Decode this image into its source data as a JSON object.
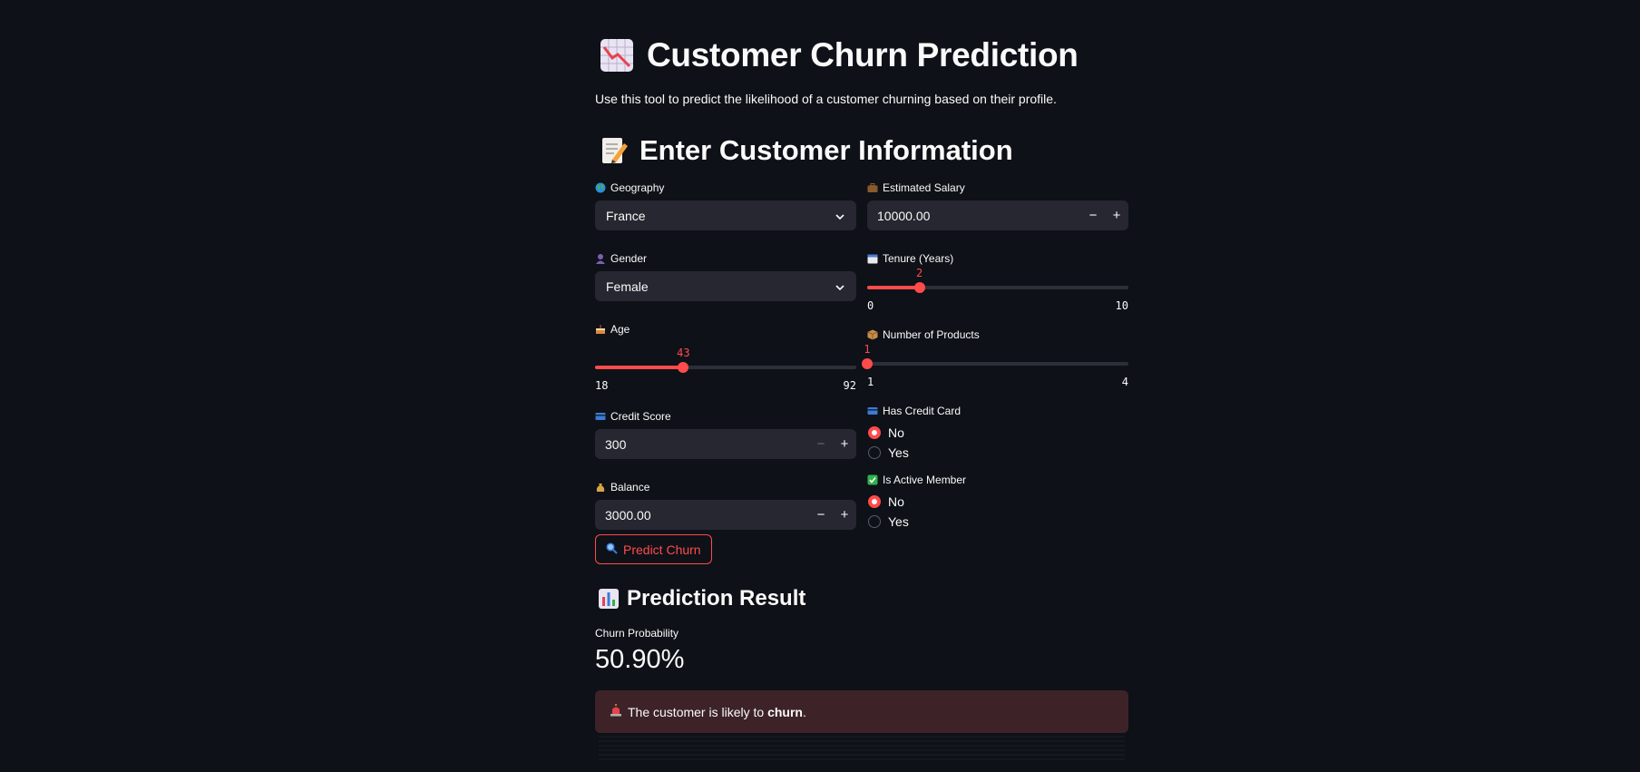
{
  "title": "Customer Churn Prediction",
  "subtitle": "Use this tool to predict the likelihood of a customer churning based on their profile.",
  "section_heading": "Enter Customer Information",
  "form": {
    "geography": {
      "label": "Geography",
      "value": "France",
      "icon": "globe-icon"
    },
    "gender": {
      "label": "Gender",
      "value": "Female",
      "icon": "person-icon"
    },
    "age": {
      "label": "Age",
      "value": "43",
      "min": "18",
      "max": "92",
      "fraction": 0.338,
      "icon": "cake-icon"
    },
    "credit_score": {
      "label": "Credit Score",
      "value": "300",
      "icon": "credit-card-icon"
    },
    "balance": {
      "label": "Balance",
      "value": "3000.00",
      "icon": "money-bag-icon"
    },
    "estimated_salary": {
      "label": "Estimated Salary",
      "value": "10000.00",
      "icon": "briefcase-icon"
    },
    "tenure": {
      "label": "Tenure (Years)",
      "value": "2",
      "min": "0",
      "max": "10",
      "fraction": 0.2,
      "icon": "calendar-icon"
    },
    "num_products": {
      "label": "Number of Products",
      "value": "1",
      "min": "1",
      "max": "4",
      "fraction": 0.0,
      "icon": "package-icon"
    },
    "has_credit_card": {
      "label": "Has Credit Card",
      "options": [
        "No",
        "Yes"
      ],
      "selected": "No",
      "icon": "credit-card-icon"
    },
    "is_active_member": {
      "label": "Is Active Member",
      "options": [
        "No",
        "Yes"
      ],
      "selected": "No",
      "icon": "check-box-icon"
    },
    "stepper_minus": "−",
    "stepper_plus": "+"
  },
  "predict_button": {
    "label": "Predict Churn",
    "icon": "magnifier-icon"
  },
  "result": {
    "heading": "Prediction Result",
    "metric_label": "Churn Probability",
    "metric_value": "50.90%",
    "alert_prefix": "The customer is likely to",
    "alert_emphasis": "churn",
    "alert_suffix": ".",
    "alert_icon": "siren-icon"
  },
  "colors": {
    "background": "#0e1117",
    "accent": "#ff4b4b",
    "input_bg": "#262730",
    "alert_bg": "#3d2328"
  }
}
